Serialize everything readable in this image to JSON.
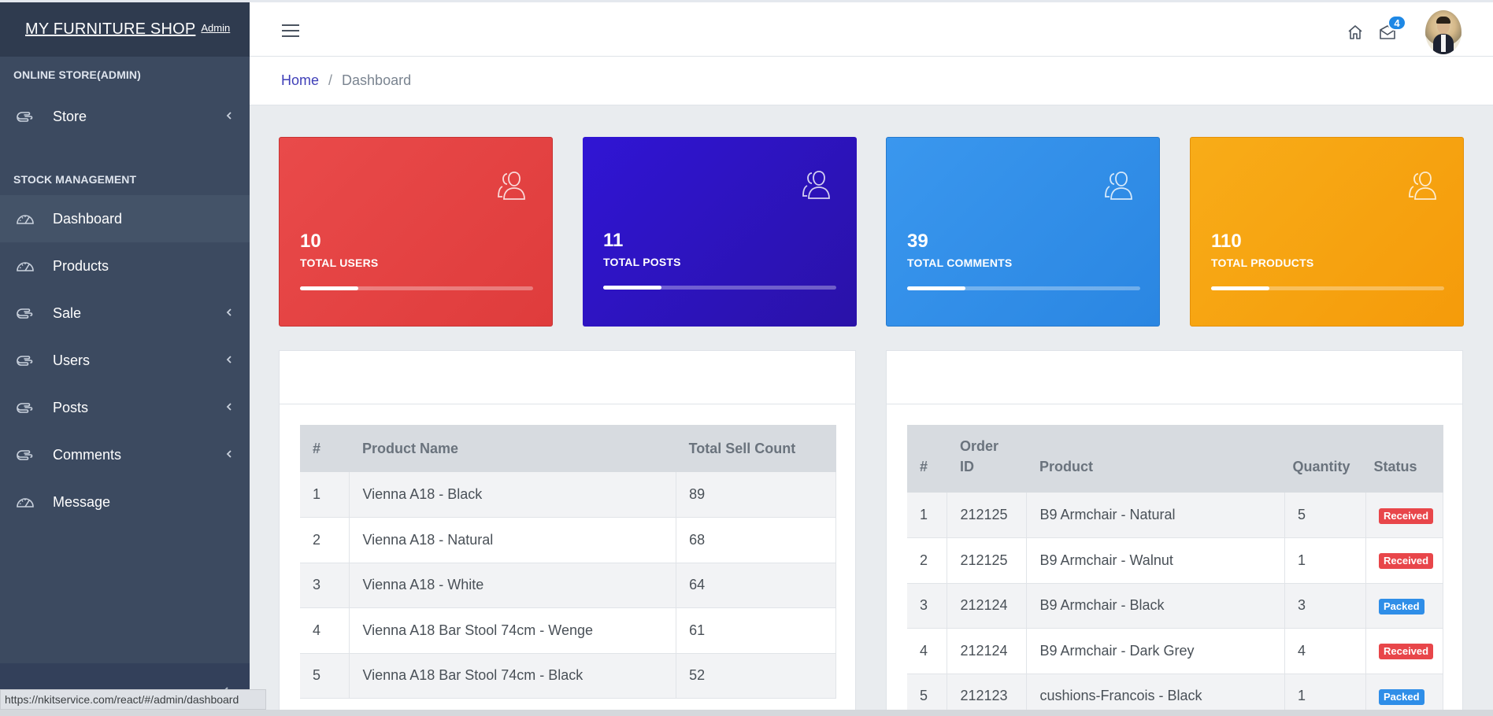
{
  "brand": {
    "title": "MY FURNITURE SHOP",
    "subtitle": "Admin"
  },
  "sidebar": {
    "sections": [
      {
        "title": "ONLINE STORE(ADMIN)"
      },
      {
        "title": "STOCK MANAGEMENT"
      }
    ],
    "items": [
      {
        "label": "Store",
        "icon": "hand-icon",
        "has_submenu": true
      },
      {
        "label": "Dashboard",
        "icon": "gauge-icon",
        "active": true
      },
      {
        "label": "Products",
        "icon": "gauge-icon"
      },
      {
        "label": "Sale",
        "icon": "hand-icon",
        "has_submenu": true
      },
      {
        "label": "Users",
        "icon": "hand-icon",
        "has_submenu": true
      },
      {
        "label": "Posts",
        "icon": "hand-icon",
        "has_submenu": true
      },
      {
        "label": "Comments",
        "icon": "hand-icon",
        "has_submenu": true
      },
      {
        "label": "Message",
        "icon": "gauge-icon"
      }
    ]
  },
  "header": {
    "mail_count": "4"
  },
  "breadcrumb": {
    "home": "Home",
    "separator": "/",
    "current": "Dashboard"
  },
  "stats": [
    {
      "value": "10",
      "label": "TOTAL USERS",
      "progress": 0.25,
      "color": "#e94a4a"
    },
    {
      "value": "11",
      "label": "TOTAL POSTS",
      "progress": 0.25,
      "color": "#2c14c2"
    },
    {
      "value": "39",
      "label": "TOTAL COMMENTS",
      "progress": 0.25,
      "color": "#3490ea"
    },
    {
      "value": "110",
      "label": "TOTAL PRODUCTS",
      "progress": 0.25,
      "color": "#f7a514"
    }
  ],
  "top_products": {
    "columns": [
      "#",
      "Product Name",
      "Total Sell Count"
    ],
    "rows": [
      [
        "1",
        "Vienna A18 - Black",
        "89"
      ],
      [
        "2",
        "Vienna A18 - Natural",
        "68"
      ],
      [
        "3",
        "Vienna A18 - White",
        "64"
      ],
      [
        "4",
        "Vienna A18 Bar Stool 74cm - Wenge",
        "61"
      ],
      [
        "5",
        "Vienna A18 Bar Stool 74cm - Black",
        "52"
      ]
    ]
  },
  "orders": {
    "columns": [
      "#",
      "Order ID",
      "Product",
      "Quantity",
      "Status"
    ],
    "rows": [
      [
        "1",
        "212125",
        "B9 Armchair - Natural",
        "5",
        "Received"
      ],
      [
        "2",
        "212125",
        "B9 Armchair - Walnut",
        "1",
        "Received"
      ],
      [
        "3",
        "212124",
        "B9 Armchair - Black",
        "3",
        "Packed"
      ],
      [
        "4",
        "212124",
        "B9 Armchair - Dark Grey",
        "4",
        "Received"
      ],
      [
        "5",
        "212123",
        "cushions-Francois - Black",
        "1",
        "Packed"
      ]
    ]
  },
  "status_bar": {
    "url": "https://nkitservice.com/react/#/admin/dashboard"
  }
}
